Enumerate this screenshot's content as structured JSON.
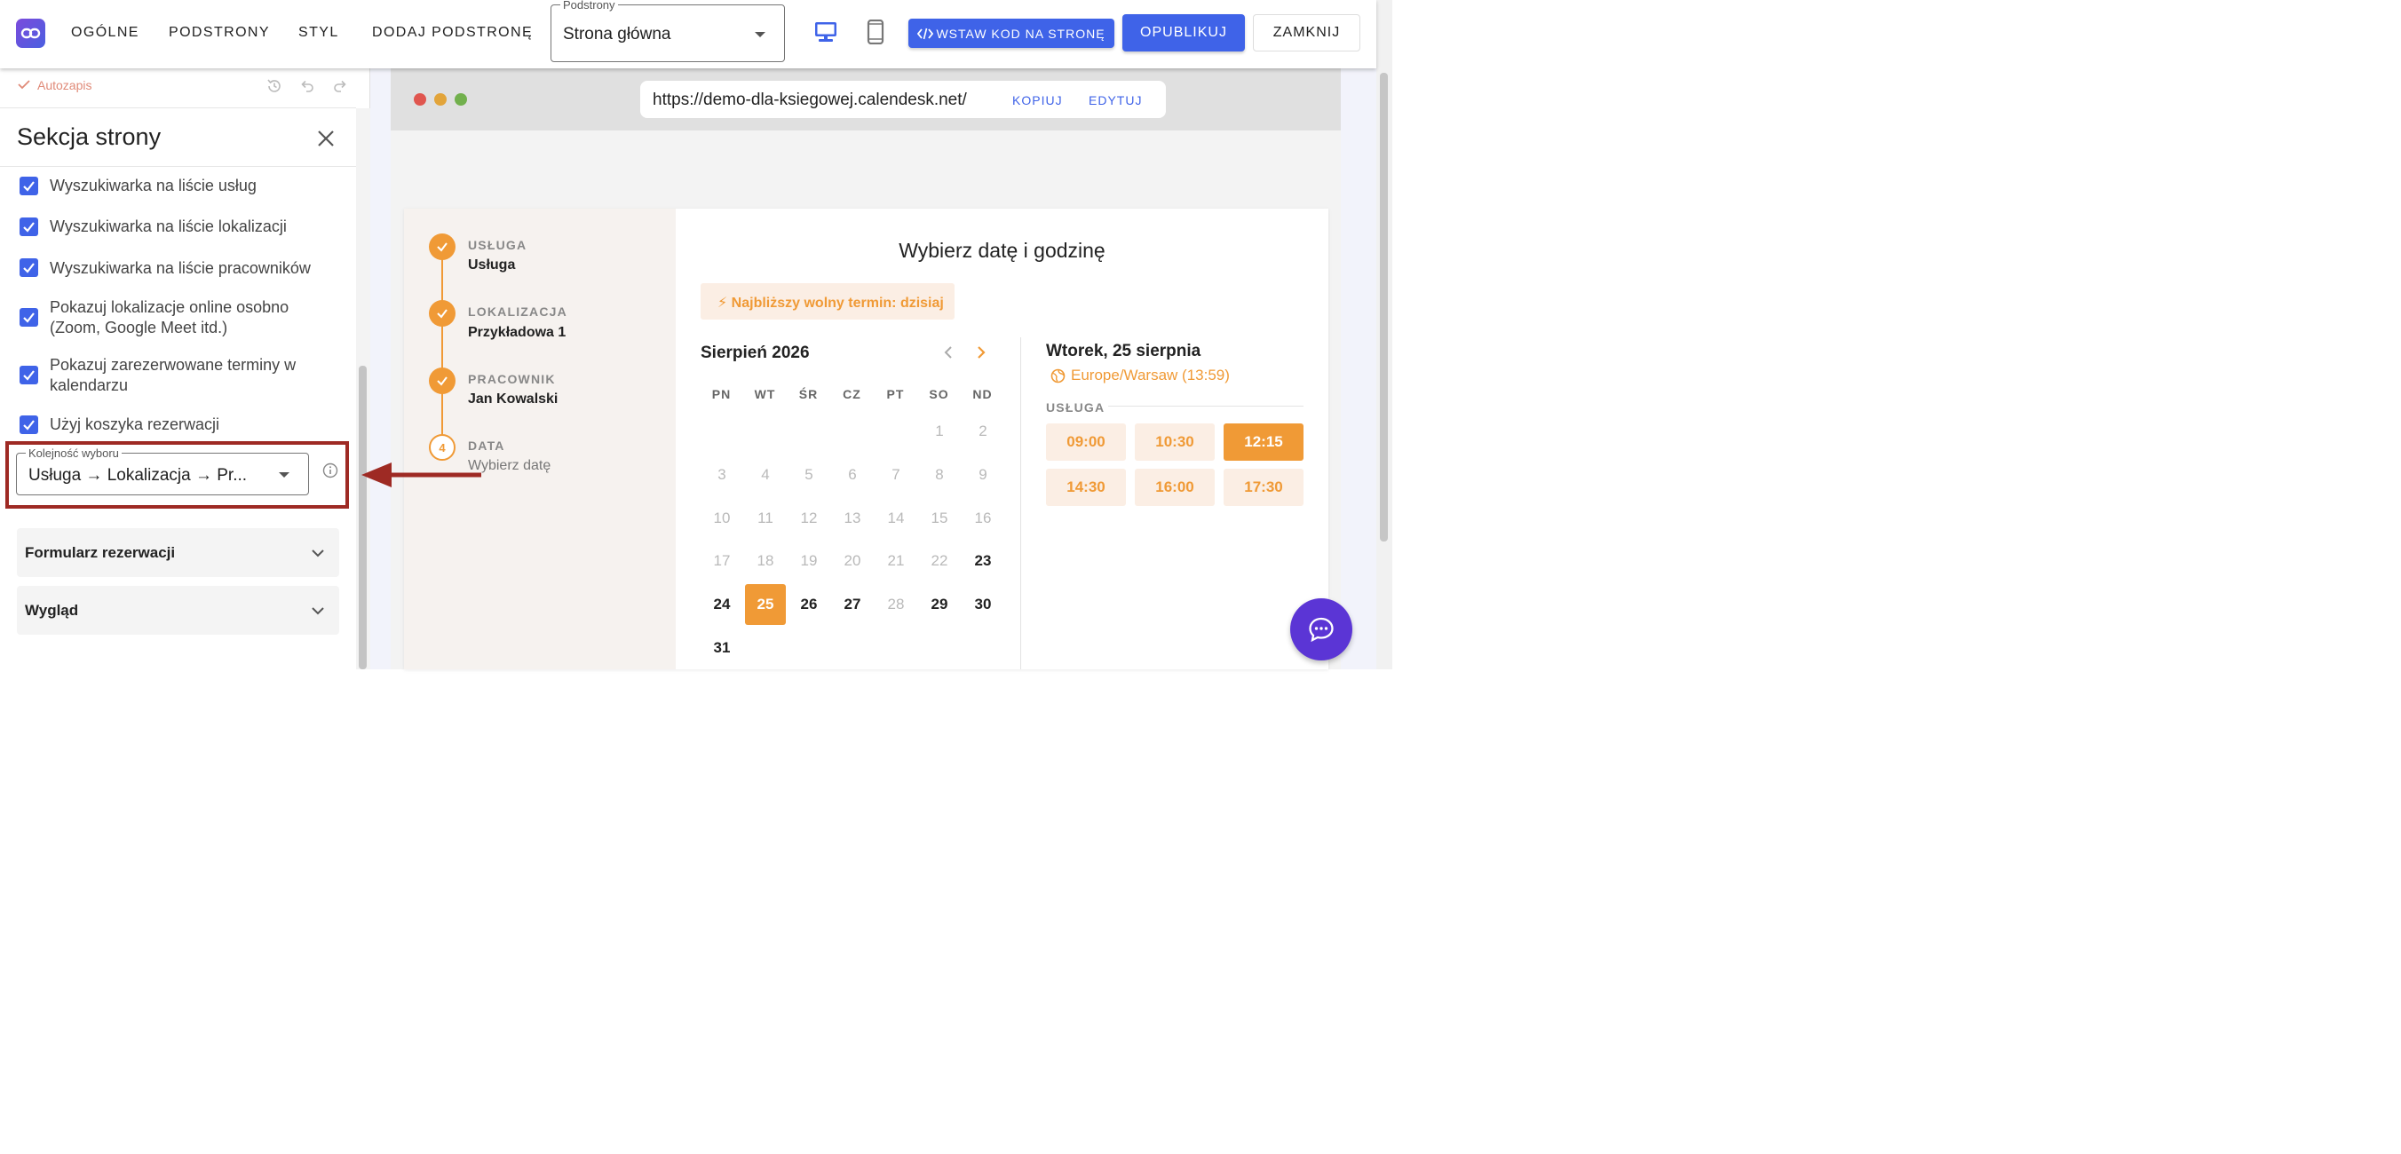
{
  "topbar": {
    "nav": [
      "OGÓLNE",
      "PODSTRONY",
      "STYL",
      "DODAJ PODSTRONĘ"
    ],
    "page_select": {
      "label": "Podstrony",
      "value": "Strona główna"
    },
    "embed_button": "WSTAW KOD NA STRONĘ",
    "publish_button": "OPUBLIKUJ",
    "close_button": "ZAMKNIJ"
  },
  "panel": {
    "autosave": "Autozapis",
    "title": "Sekcja strony",
    "checkboxes": [
      "Wyszukiwarka na liście usług",
      "Wyszukiwarka na liście lokalizacji",
      "Wyszukiwarka na liście pracowników",
      "Pokazuj lokalizacje online osobno (Zoom, Google Meet itd.)",
      "Pokazuj zarezerwowane terminy w kalendarzu",
      "Użyj koszyka rezerwacji"
    ],
    "order_field": {
      "label": "Kolejność wyboru",
      "value": "Usługa → Lokalizacja → Pr..."
    },
    "accordions": [
      "Formularz rezerwacji",
      "Wygląd"
    ]
  },
  "browser": {
    "url": "https://demo-dla-ksiegowej.calendesk.net/",
    "copy": "KOPIUJ",
    "edit": "EDYTUJ"
  },
  "widget": {
    "steps": [
      {
        "title": "USŁUGA",
        "value": "Usługa",
        "done": true
      },
      {
        "title": "LOKALIZACJA",
        "value": "Przykładowa 1",
        "done": true
      },
      {
        "title": "PRACOWNIK",
        "value": "Jan Kowalski",
        "done": true
      },
      {
        "title": "DATA",
        "value": "Wybierz datę",
        "done": false,
        "number": "4"
      }
    ],
    "heading": "Wybierz datę i godzinę",
    "nearest": "⚡ Najbliższy wolny termin: dzisiaj",
    "month": "Sierpień 2026",
    "weekdays": [
      "PN",
      "WT",
      "ŚR",
      "CZ",
      "PT",
      "SO",
      "ND"
    ],
    "selected_day_title": "Wtorek, 25 sierpnia",
    "timezone": "Europe/Warsaw (13:59)",
    "service_label": "USŁUGA",
    "slots": [
      "09:00",
      "10:30",
      "12:15",
      "14:30",
      "16:00",
      "17:30"
    ],
    "selected_slot": "12:15",
    "days": [
      [
        "",
        "",
        "",
        "",
        "",
        "1",
        "2"
      ],
      [
        "3",
        "4",
        "5",
        "6",
        "7",
        "8",
        "9"
      ],
      [
        "10",
        "11",
        "12",
        "13",
        "14",
        "15",
        "16"
      ],
      [
        "17",
        "18",
        "19",
        "20",
        "21",
        "22",
        "23"
      ],
      [
        "24",
        "25",
        "26",
        "27",
        "28",
        "29",
        "30"
      ],
      [
        "31",
        "",
        "",
        "",
        "",
        "",
        ""
      ]
    ],
    "available_days": [
      "23",
      "24",
      "26",
      "27",
      "29",
      "30",
      "31"
    ],
    "selected_day": "25"
  },
  "colors": {
    "primary": "#3f63e8",
    "accent": "#f09a36",
    "annotation": "#9e2a24",
    "chat": "#5b35d5"
  }
}
